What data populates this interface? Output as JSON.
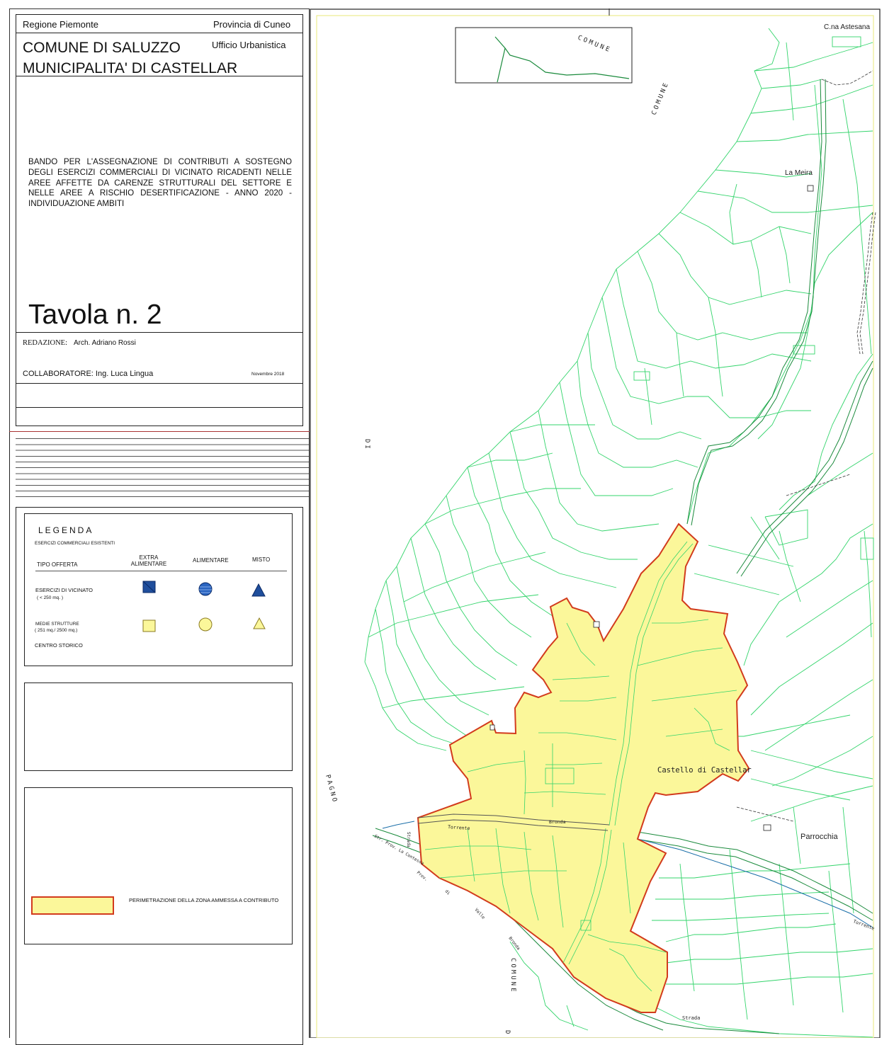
{
  "header": {
    "region": "Regione Piemonte",
    "province": "Provincia di Cuneo",
    "comune": "COMUNE DI SALUZZO",
    "municipalita": "MUNICIPALITA' DI CASTELLAR",
    "ufficio": "Ufficio Urbanistica"
  },
  "project": {
    "bando": "BANDO PER L'ASSEGNAZIONE DI CONTRIBUTI A SOSTEGNO DEGLI ESERCIZI COMMERCIALI DI VICINATO RICADENTI NELLE AREE AFFETTE DA CARENZE STRUTTURALI DEL SETTORE E NELLE AREE A RISCHIO DESERTIFICAZIONE - ANNO 2020 - INDIVIDUAZIONE AMBITI",
    "tavola": "Tavola n. 2"
  },
  "credits": {
    "redazione_label": "REDAZIONE:",
    "redazione_name": "Arch. Adriano Rossi",
    "collaboratore": "COLLABORATORE: Ing. Luca Lingua",
    "date": "Novembre 2018"
  },
  "legend": {
    "title": "LEGENDA",
    "subtitle": "ESERCIZI COMMERCIALI ESISTENTI",
    "tipo_offerta": "TIPO OFFERTA",
    "col_extra_1": "EXTRA",
    "col_extra_2": "ALIMENTARE",
    "col_alimentare": "ALIMENTARE",
    "col_misto": "MISTO",
    "row_vicinato_1": "ESERCIZI DI VICINATO",
    "row_vicinato_2": "( < 250 mq. )",
    "row_medie_1": "MEDIE STRUTTURE",
    "row_medie_2": "( 251 mq./ 2500 mq.)",
    "row_centro": "CENTRO STORICO",
    "perimetrazione": "PERIMETRAZIONE DELLA ZONA AMMESSA A CONTRIBUTO",
    "colors": {
      "vicinato": "#1f4e9c",
      "medie": "#fbf79a",
      "zone_fill": "#fbf79a",
      "zone_border": "#d23b1d",
      "parcels": "#33d46b"
    }
  },
  "map": {
    "labels": {
      "cna_astesana": "C.na Astesana",
      "la_meira": "La Meira",
      "castello": "Castello di Castellar",
      "parrocchia": "Parrocchia",
      "torrente": "Torrente",
      "bronda": "Bronda",
      "comune_1": "COMUNE",
      "comune_2": "COMUNE",
      "comune_3": "COMUNE",
      "di_1": "DI",
      "pagno": "PAGNO",
      "strada_1": "Strada",
      "strada_2": "Strada",
      "str_prov": "Str. Prov. La Contessa",
      "prov": "Prov.",
      "di_2": "di",
      "valle": "Valle",
      "bronda_2": "Bronda",
      "torrente_2": "Torrente",
      "di_3": "D"
    }
  }
}
